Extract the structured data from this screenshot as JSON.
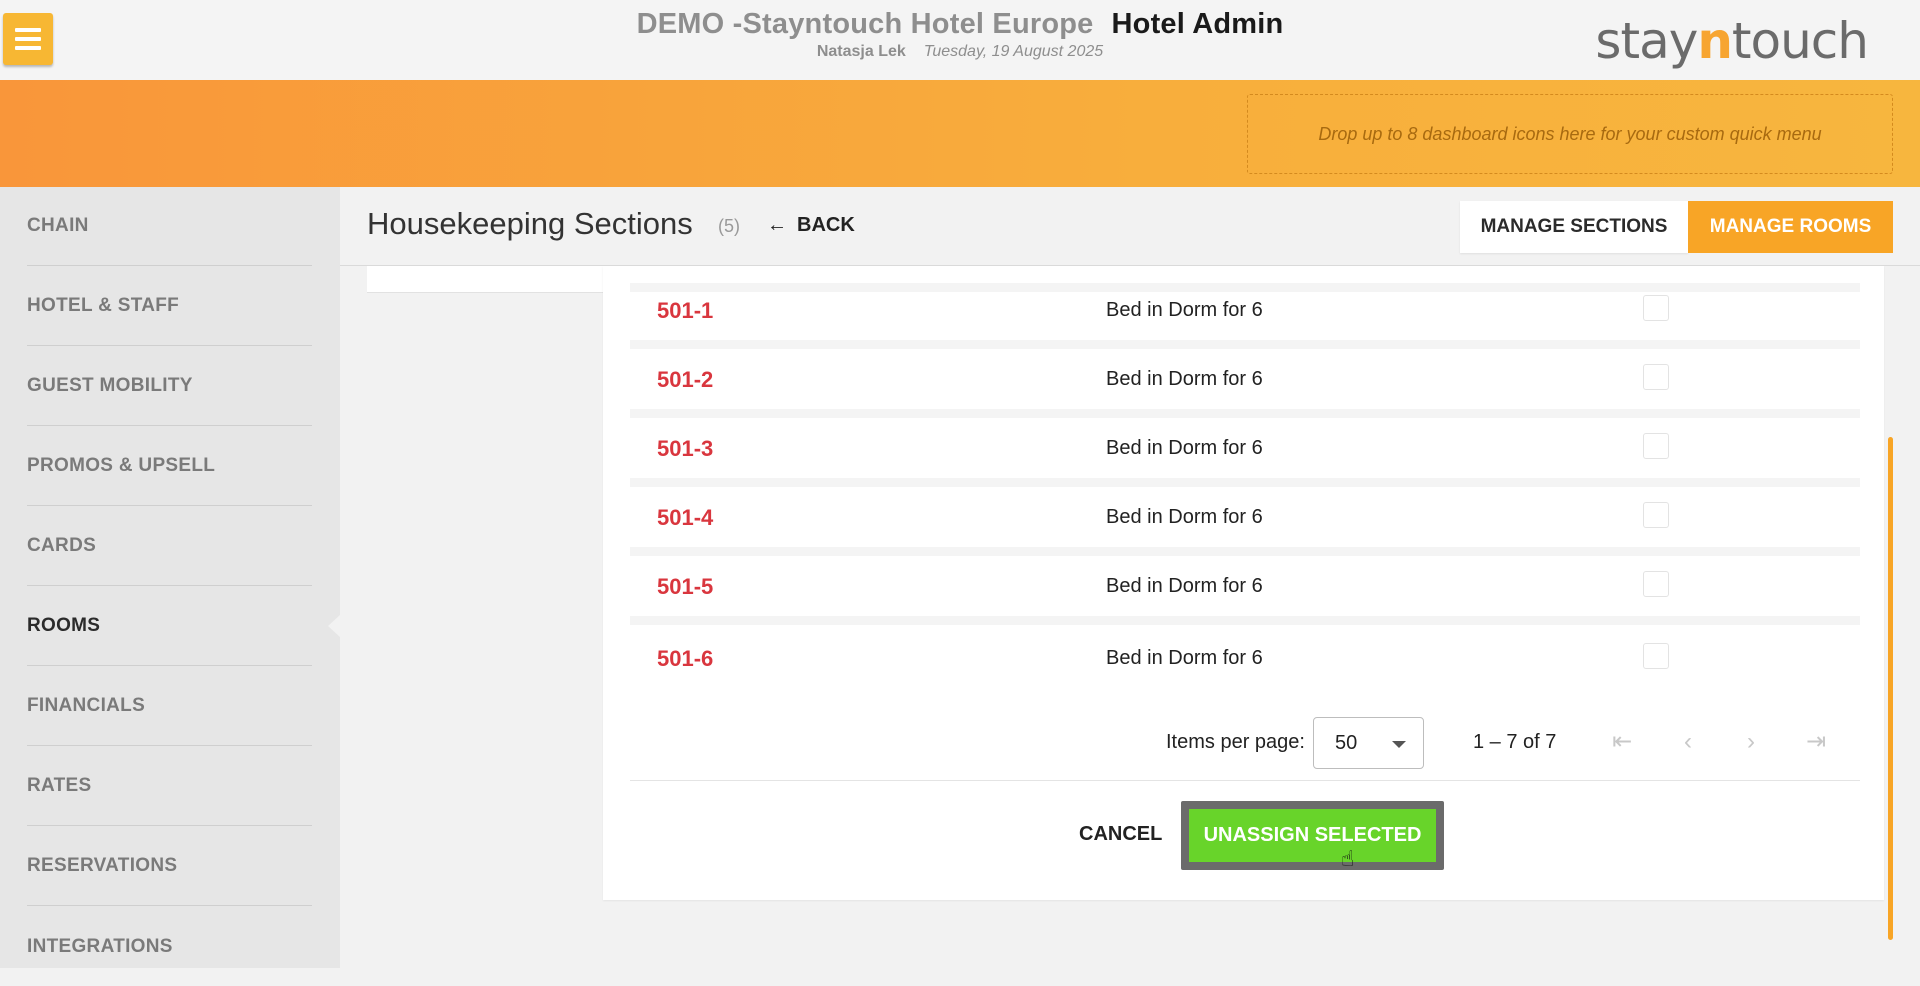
{
  "header": {
    "hotel_name": "DEMO -Stayntouch Hotel Europe",
    "app_name": "Hotel Admin",
    "user": "Natasja Lek",
    "date": "Tuesday, 19 August 2025",
    "logo_pre": "stay",
    "logo_n": "n",
    "logo_post": "touch",
    "menu_icon": "hamburger-icon"
  },
  "quick_menu": {
    "placeholder": "Drop up to 8 dashboard icons here for your custom quick menu"
  },
  "sidebar": {
    "active": "ROOMS",
    "items": [
      {
        "label": "CHAIN"
      },
      {
        "label": "HOTEL & STAFF"
      },
      {
        "label": "GUEST MOBILITY"
      },
      {
        "label": "PROMOS & UPSELL"
      },
      {
        "label": "CARDS"
      },
      {
        "label": "ROOMS"
      },
      {
        "label": "FINANCIALS"
      },
      {
        "label": "RATES"
      },
      {
        "label": "RESERVATIONS"
      },
      {
        "label": "INTEGRATIONS"
      }
    ]
  },
  "page": {
    "title": "Housekeeping Sections",
    "count": "(5)",
    "back_arrow": "←",
    "back_label": "BACK",
    "manage_sections_label": "MANAGE SECTIONS",
    "manage_rooms_label": "MANAGE ROOMS"
  },
  "rooms": [
    {
      "number": "501-1",
      "type": "Bed in Dorm for 6",
      "selected": false
    },
    {
      "number": "501-2",
      "type": "Bed in Dorm for 6",
      "selected": false
    },
    {
      "number": "501-3",
      "type": "Bed in Dorm for 6",
      "selected": false
    },
    {
      "number": "501-4",
      "type": "Bed in Dorm for 6",
      "selected": false
    },
    {
      "number": "501-5",
      "type": "Bed in Dorm for 6",
      "selected": false
    },
    {
      "number": "501-6",
      "type": "Bed in Dorm for 6",
      "selected": false
    }
  ],
  "pagination": {
    "items_per_page_label": "Items per page:",
    "items_per_page": "50",
    "range": "1 – 7 of 7",
    "first_icon": "⇤",
    "prev_icon": "‹",
    "next_icon": "›",
    "last_icon": "⇥"
  },
  "actions": {
    "cancel_label": "CANCEL",
    "unassign_label": "UNASSIGN SELECTED"
  },
  "colors": {
    "accent_orange": "#f8a526",
    "room_red": "#d9363e",
    "action_green": "#68d42a"
  }
}
